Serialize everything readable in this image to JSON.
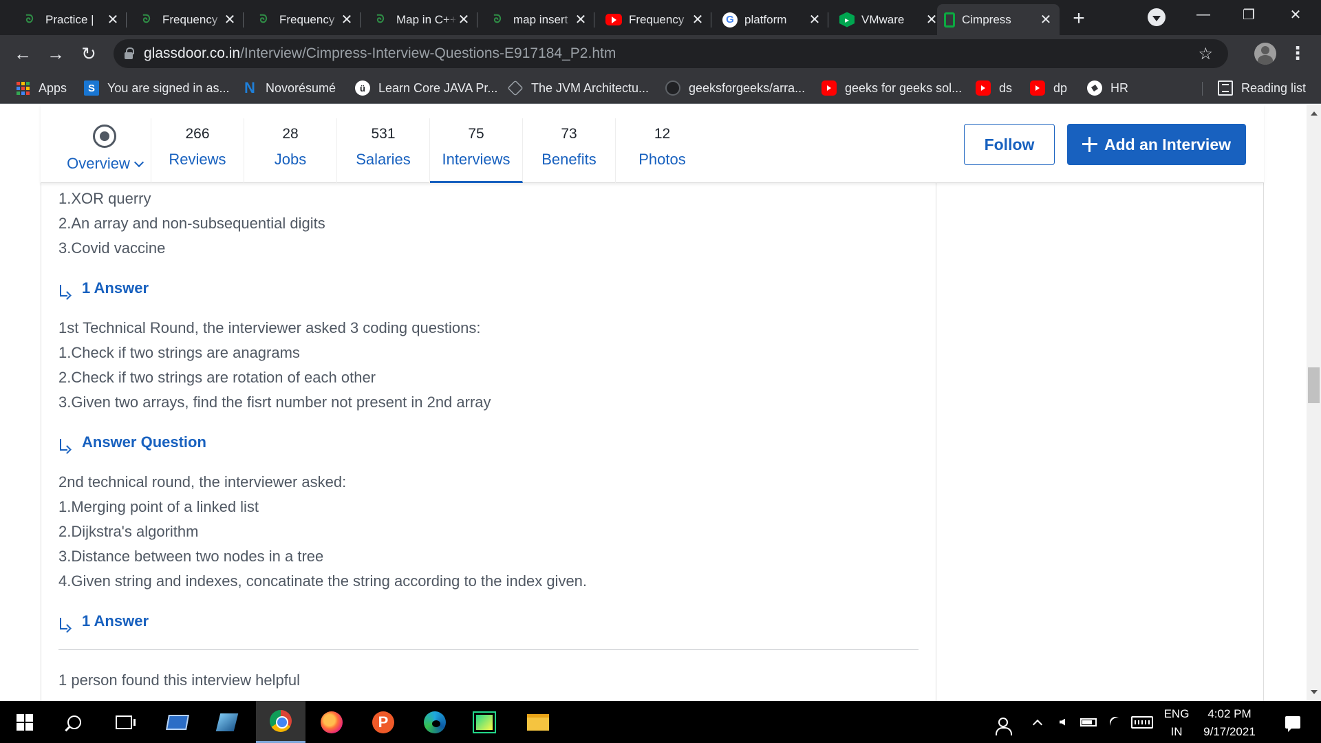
{
  "browser": {
    "tabs": [
      {
        "title": "Practice |",
        "favicon": "gfg-icon",
        "active": false
      },
      {
        "title": "Frequency",
        "favicon": "gfg-icon",
        "active": false
      },
      {
        "title": "Frequency",
        "favicon": "gfg-icon",
        "active": false
      },
      {
        "title": "Map in C++",
        "favicon": "gfg-icon",
        "active": false
      },
      {
        "title": "map insert",
        "favicon": "gfg-icon",
        "active": false
      },
      {
        "title": "Frequency",
        "favicon": "youtube-icon",
        "active": false
      },
      {
        "title": "platform",
        "favicon": "google-icon",
        "active": false
      },
      {
        "title": "VMware",
        "favicon": "vmware-icon",
        "active": false
      },
      {
        "title": "Cimpress",
        "favicon": "glassdoor-icon",
        "active": true
      }
    ],
    "tab_close_glyph": "✕",
    "new_tab_glyph": "+",
    "window_controls": {
      "minimize": "—",
      "restore": "❐",
      "close": "✕"
    },
    "nav": {
      "back": "←",
      "forward": "→",
      "reload": "↻"
    },
    "address": {
      "host": "glassdoor.co.in",
      "path": "/Interview/Cimpress-Interview-Questions-E917184_P2.htm"
    },
    "bookmark_star": "☆",
    "menu_glyph": "⋮",
    "bookmarks": [
      {
        "label": "Apps",
        "icon": "apps-grid-icon"
      },
      {
        "label": "You are signed in as...",
        "icon": "s-logo-icon"
      },
      {
        "label": "Novorésumé",
        "icon": "novoresume-icon"
      },
      {
        "label": "Learn Core JAVA Pr...",
        "icon": "udemy-icon"
      },
      {
        "label": "The JVM Architectu...",
        "icon": "hexagon-icon"
      },
      {
        "label": "geeksforgeeks/arra...",
        "icon": "github-icon"
      },
      {
        "label": "geeks for geeks sol...",
        "icon": "youtube-icon"
      },
      {
        "label": "ds",
        "icon": "youtube-icon"
      },
      {
        "label": "dp",
        "icon": "youtube-icon"
      },
      {
        "label": "HR",
        "icon": "globe-icon"
      }
    ],
    "reading_list": "Reading list"
  },
  "company_nav": {
    "overview_label": "Overview",
    "items": [
      {
        "count": "266",
        "label": "Reviews"
      },
      {
        "count": "28",
        "label": "Jobs"
      },
      {
        "count": "531",
        "label": "Salaries"
      },
      {
        "count": "75",
        "label": "Interviews",
        "active": true
      },
      {
        "count": "73",
        "label": "Benefits"
      },
      {
        "count": "12",
        "label": "Photos"
      }
    ],
    "follow_label": "Follow",
    "add_interview_label": "Add an Interview"
  },
  "interview": {
    "block1": {
      "lines": [
        "1.XOR querry",
        "2.An array and non-subsequential digits",
        "3.Covid vaccine"
      ],
      "answer_link": "1 Answer"
    },
    "block2": {
      "lines": [
        "1st Technical Round, the interviewer asked 3 coding questions:",
        "1.Check if two strings are anagrams",
        "2.Check if two strings are rotation of each other",
        "3.Given two arrays, find the fisrt number not present in 2nd array"
      ],
      "answer_link": "Answer Question"
    },
    "block3": {
      "lines": [
        "2nd technical round, the interviewer asked:",
        "1.Merging point of a linked list",
        "2.Dijkstra's algorithm",
        "3.Distance between two nodes in a tree",
        "4.Given string and indexes, concatinate the string according to the index given."
      ],
      "answer_link": "1 Answer"
    },
    "helpful_text": "1 person found this interview helpful"
  },
  "taskbar": {
    "language_top": "ENG",
    "language_bottom": "IN",
    "time": "4:02 PM",
    "date": "9/17/2021"
  },
  "colors": {
    "glassdoor_blue": "#1861bf",
    "body_text": "#505863",
    "chrome_dark": "#202124",
    "chrome_toolbar": "#35363a"
  }
}
